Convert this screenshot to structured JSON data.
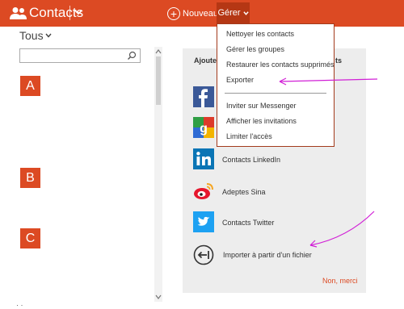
{
  "header": {
    "title": "Contacts",
    "new_label": "Nouveau",
    "manage_label": "Gérer",
    "bg_color": "#dc4a23"
  },
  "filter": {
    "label": "Tous"
  },
  "search": {
    "placeholder": ""
  },
  "letters": [
    "A",
    "B",
    "C"
  ],
  "manage_menu": {
    "items": [
      "Nettoyer les contacts",
      "Gérer les groupes",
      "Restaurer les contacts supprimés",
      "Exporter",
      "Inviter sur Messenger",
      "Afficher les invitations",
      "Limiter l'accès"
    ],
    "highlighted": "Exporter"
  },
  "add_panel": {
    "title_start": "Ajouter",
    "title_end": "ts",
    "services": [
      {
        "label": "",
        "icon": "facebook-icon"
      },
      {
        "label": "",
        "icon": "google-icon"
      },
      {
        "label": "Contacts LinkedIn",
        "icon": "linkedin-icon"
      },
      {
        "label": "Adeptes Sina",
        "icon": "sina-weibo-icon"
      },
      {
        "label": "Contacts Twitter",
        "icon": "twitter-icon"
      }
    ],
    "import_label": "Importer à partir d'un fichier",
    "dismiss_label": "Non, merci"
  },
  "colors": {
    "accent": "#dc4a23",
    "menu_active": "#b53714",
    "annotation": "#d11fd6"
  }
}
